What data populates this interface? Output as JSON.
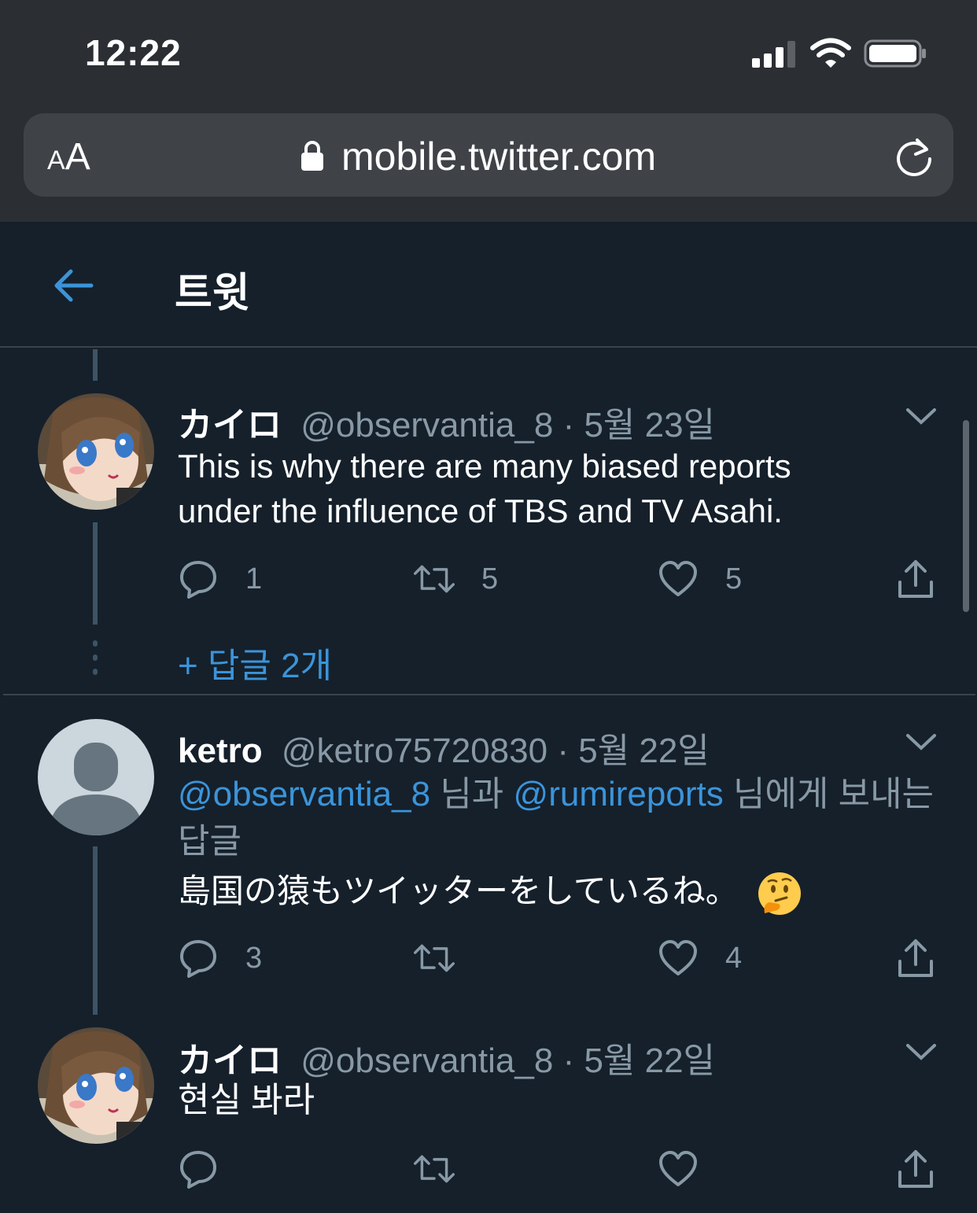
{
  "status_bar": {
    "time": "12:22"
  },
  "browser": {
    "text_size_label_small": "A",
    "text_size_label_large": "A",
    "url": "mobile.twitter.com"
  },
  "header": {
    "title": "트윗"
  },
  "tweets": [
    {
      "name": "カイロ",
      "handle": "@observantia_8",
      "date": "· 5월 23일",
      "text_line1": "This is why there are many biased reports",
      "text_line2": "under the influence of TBS and TV Asahi.",
      "replies": "1",
      "retweets": "5",
      "likes": "5"
    },
    {
      "name": "ketro",
      "handle": "@ketro75720830",
      "date": "· 5월 22일",
      "reply_to_user1": "@observantia_8",
      "reply_to_mid": "님과",
      "reply_to_user2": "@rumireports",
      "reply_to_suffix": "님에게 보내는",
      "reply_to_end": "답글",
      "text": "島国の猿もツイッターをしているね。",
      "emoji": "🤔",
      "replies": "3",
      "retweets": "",
      "likes": "4"
    },
    {
      "name": "カイロ",
      "handle": "@observantia_8",
      "date": "· 5월 22일",
      "text": "현실 봐라",
      "replies": "",
      "retweets": "",
      "likes": ""
    }
  ],
  "more_replies": "+ 답글 2개",
  "colors": {
    "background": "#15202b",
    "accent": "#3b94d9",
    "muted": "#8899a6",
    "chrome": "#2b2f34"
  },
  "icons": [
    "signal-icon",
    "wifi-icon",
    "battery-icon",
    "lock-icon",
    "reload-icon",
    "back-arrow-icon",
    "chevron-down-icon",
    "reply-icon",
    "retweet-icon",
    "like-icon",
    "share-icon"
  ]
}
